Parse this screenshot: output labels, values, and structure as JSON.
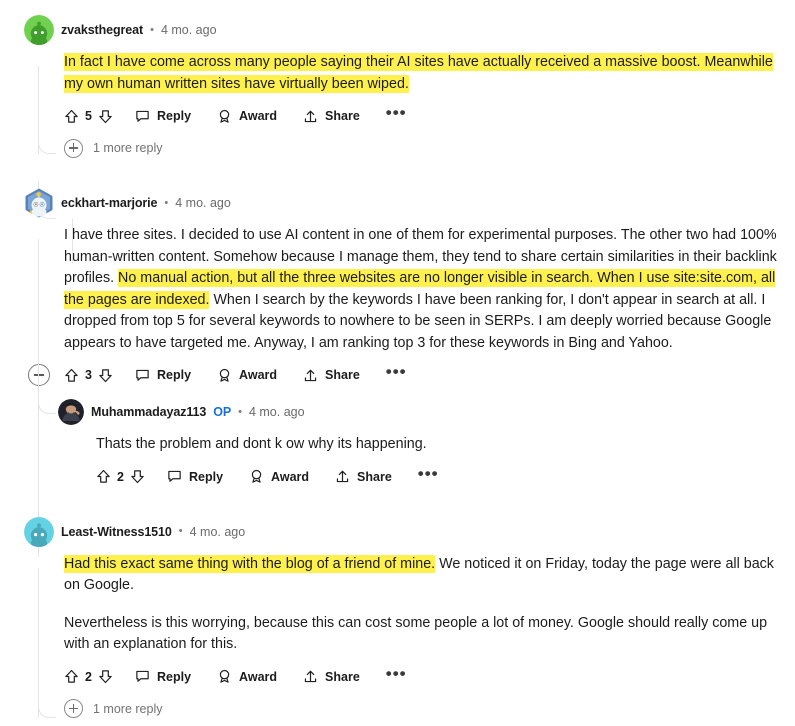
{
  "comments": [
    {
      "id": "c1",
      "username": "zvaksthegreat",
      "timestamp": "4 mo. ago",
      "avatar_color": "#5ecb4a",
      "avatar_type": "snoo-green",
      "op": false,
      "vote_count": "5",
      "paragraphs": [
        {
          "segments": [
            {
              "text": "In fact I have come across many people saying their AI sites have actually received a massive boost. Meanwhile my own human written sites have virtually been wiped.",
              "highlight": true
            }
          ]
        }
      ],
      "more_replies_label": "1 more reply"
    },
    {
      "id": "c2",
      "username": "eckhart-marjorie",
      "timestamp": "4 mo. ago",
      "avatar_color": "#3f6fa8",
      "avatar_type": "snoo-blue-hex",
      "op": false,
      "vote_count": "3",
      "paragraphs": [
        {
          "segments": [
            {
              "text": "I have three sites. I decided to use AI content in one of them for experimental purposes. The other two had 100% human-written content. Somehow because I manage them, they tend to share certain similarities in their backlink profiles. ",
              "highlight": false
            },
            {
              "text": "No manual action, but all the three websites are no longer visible in search. When I use site:site.com, all the pages are indexed.",
              "highlight": true
            },
            {
              "text": " When I search by the keywords I have been ranking for, I don't appear in search at all. I dropped from top 5 for several keywords to nowhere to be seen in SERPs. I am deeply worried because Google appears to have targeted me. Anyway, I am ranking top 3 for these keywords in Bing and Yahoo.",
              "highlight": false
            }
          ]
        }
      ],
      "reply": {
        "id": "c2r1",
        "username": "Muhammadayaz113",
        "op_label": "OP",
        "timestamp": "4 mo. ago",
        "avatar_color": "#2b2b33",
        "avatar_type": "photo-person",
        "op": true,
        "vote_count": "2",
        "paragraphs": [
          {
            "segments": [
              {
                "text": "Thats the problem and dont k ow why its happening.",
                "highlight": false
              }
            ]
          }
        ]
      }
    },
    {
      "id": "c3",
      "username": "Least-Witness1510",
      "timestamp": "4 mo. ago",
      "avatar_color": "#5fd0e0",
      "avatar_type": "snoo-cyan",
      "op": false,
      "vote_count": "2",
      "paragraphs": [
        {
          "segments": [
            {
              "text": "Had this exact same thing with the blog of a friend of mine.",
              "highlight": true
            },
            {
              "text": " We noticed it on Friday, today the page were all back on Google.",
              "highlight": false
            }
          ]
        },
        {
          "segments": [
            {
              "text": "Nevertheless is this worrying, because this can cost some people a lot of money. Google should really come up with an explanation for this.",
              "highlight": false
            }
          ]
        }
      ],
      "more_replies_label": "1 more reply"
    }
  ],
  "actions": {
    "reply_label": "Reply",
    "award_label": "Award",
    "share_label": "Share",
    "more_label": "•••",
    "upvote_icon": "upvote-arrow-icon",
    "downvote_icon": "downvote-arrow-icon",
    "reply_icon": "speech-bubble-icon",
    "award_icon": "award-ribbon-icon",
    "share_icon": "share-arrow-icon",
    "collapse_icon": "collapse-minus-icon",
    "expand_icon": "expand-plus-icon"
  },
  "separator": "•",
  "colors": {
    "highlight": "#fff14d",
    "op_blue": "#1a6ed8",
    "thread_line": "#e2e4e6",
    "text": "#1c1c1c",
    "muted": "#6a6a6a"
  }
}
